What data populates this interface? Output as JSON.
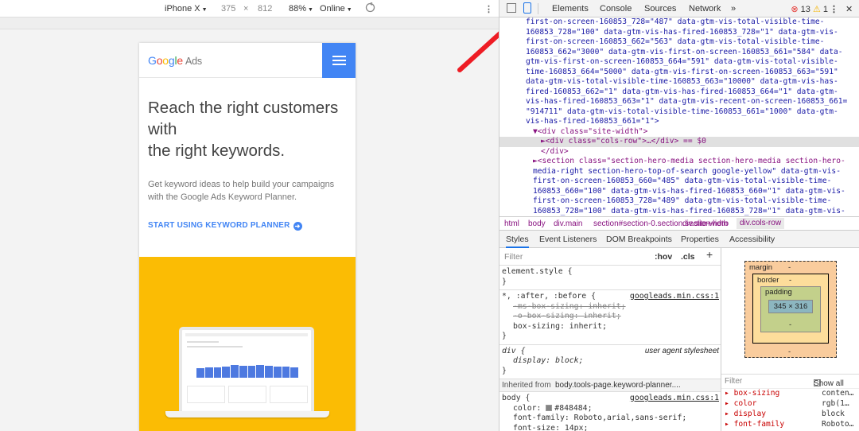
{
  "device_toolbar": {
    "device": "iPhone X",
    "width": "375",
    "times": "×",
    "height": "812",
    "zoom": "88%",
    "network": "Online",
    "more": "⋮"
  },
  "site": {
    "logo_google": "Google",
    "logo_ads": "Ads",
    "headline_1": "Reach the right customers",
    "headline_2": "with",
    "headline_3": "the right keywords.",
    "body": "Get keyword ideas to help build your campaigns with the Google Ads Keyword Planner.",
    "cta": "START USING KEYWORD PLANNER",
    "cta_icon": "arrow-right-circle-icon",
    "hero_color": "#fbbc04",
    "accent": "#4285f4"
  },
  "devtools": {
    "tabs": [
      "Elements",
      "Console",
      "Sources",
      "Network"
    ],
    "overflow": "»",
    "error_count": "13",
    "warning_count": "1",
    "dom_lines": [
      {
        "text": "first-on-screen-160853_728=\"487\" data-gtm-vis-total-visible-time-",
        "cls": "cont"
      },
      {
        "text": "160853_728=\"100\" data-gtm-vis-has-fired-160853_728=\"1\" data-gtm-vis-",
        "cls": "cont"
      },
      {
        "text": "first-on-screen-160853_662=\"563\" data-gtm-vis-total-visible-time-",
        "cls": "cont"
      },
      {
        "text": "160853_662=\"3000\" data-gtm-vis-first-on-screen-160853_661=\"584\" data-",
        "cls": "cont"
      },
      {
        "text": "gtm-vis-first-on-screen-160853_664=\"591\" data-gtm-vis-total-visible-",
        "cls": "cont"
      },
      {
        "text": "time-160853_664=\"5000\" data-gtm-vis-first-on-screen-160853_663=\"591\"",
        "cls": "cont"
      },
      {
        "text": "data-gtm-vis-total-visible-time-160853_663=\"10000\" data-gtm-vis-has-",
        "cls": "cont"
      },
      {
        "text": "fired-160853_662=\"1\" data-gtm-vis-has-fired-160853_664=\"1\" data-gtm-",
        "cls": "cont"
      },
      {
        "text": "vis-has-fired-160853_663=\"1\" data-gtm-vis-recent-on-screen-160853_661=",
        "cls": "cont"
      },
      {
        "text": "\"914711\" data-gtm-vis-total-visible-time-160853_661=\"1000\" data-gtm-",
        "cls": "cont"
      },
      {
        "text": "vis-has-fired-160853_661=\"1\">",
        "cls": "cont"
      },
      {
        "text": "▼<div class=\"site-width\">",
        "cls": "tag1"
      },
      {
        "text": "►<div class=\"cols-row\">…</div> == $0",
        "cls": "tag2 hl"
      },
      {
        "text": "</div>",
        "cls": "tag1b"
      },
      {
        "text": "►<section class=\"section-hero-media section-hero-media section-hero-",
        "cls": "tag0"
      },
      {
        "text": "media-right section-hero-top-of-search google-yellow\" data-gtm-vis-",
        "cls": "cont2"
      },
      {
        "text": "first-on-screen-160853_660=\"485\" data-gtm-vis-total-visible-time-",
        "cls": "cont2"
      },
      {
        "text": "160853_660=\"100\" data-gtm-vis-has-fired-160853_660=\"1\" data-gtm-vis-",
        "cls": "cont2"
      },
      {
        "text": "first-on-screen-160853_728=\"489\" data-gtm-vis-total-visible-time-",
        "cls": "cont2"
      },
      {
        "text": "160853_728=\"100\" data-gtm-vis-has-fired-160853_728=\"1\" data-gtm-vis-",
        "cls": "cont2"
      },
      {
        "text": "first-on-screen-160853_662=\"563\" data-gtm-vis-total-visible-time-",
        "cls": "cont2"
      }
    ],
    "breadcrumbs": [
      "html",
      "body",
      "div.main",
      "section#section-0.section.section-hero",
      "div.site-width",
      "div.cols-row"
    ],
    "style_tabs": [
      "Styles",
      "Event Listeners",
      "DOM Breakpoints",
      "Properties",
      "Accessibility"
    ],
    "filter_placeholder": "Filter",
    "hov": ":hov",
    "cls": ".cls",
    "plus": "+",
    "rules": {
      "element_style": "element.style {",
      "close": "}",
      "universal_selector": "*, :after, :before {",
      "universal_source": "googleads.min.css:1",
      "ms_box": "-ms-box-sizing: inherit;",
      "o_box": "-o-box-sizing: inherit;",
      "box_sizing": "box-sizing: inherit;",
      "div_selector": "div {",
      "div_source": "user agent stylesheet",
      "display_block": "display: block;",
      "inherited_label": "Inherited from",
      "inherited_selector": "body.tools-page.keyword-planner....",
      "body_selector": "body {",
      "body_source": "googleads.min.css:1",
      "color_prop": "color: ",
      "color_val": "#848484;",
      "font_family": "font-family: Roboto,arial,sans-serif;",
      "font_size": "font-size: 14px;"
    },
    "box_model": {
      "margin": "margin",
      "margin_val": "-",
      "border": "border",
      "border_val": "-",
      "padding": "padding",
      "padding_val": "-",
      "content": "345 × 316"
    },
    "computed": {
      "filter": "Filter",
      "show_all": "Show all",
      "props": [
        {
          "name": "box-sizing",
          "value": "conten…"
        },
        {
          "name": "color",
          "value": "rgb(1…"
        },
        {
          "name": "display",
          "value": "block"
        },
        {
          "name": "font-family",
          "value": "Roboto…"
        }
      ]
    }
  }
}
